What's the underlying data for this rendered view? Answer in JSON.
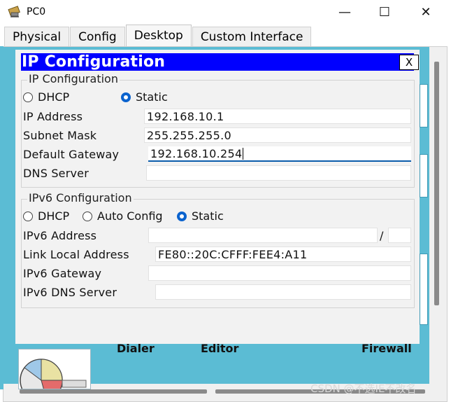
{
  "window": {
    "title": "PC0",
    "minimize_glyph": "—",
    "maximize_glyph": "☐",
    "close_glyph": "✕"
  },
  "tabs": [
    {
      "label": "Physical",
      "active": false
    },
    {
      "label": "Config",
      "active": false
    },
    {
      "label": "Desktop",
      "active": true
    },
    {
      "label": "Custom Interface",
      "active": false
    }
  ],
  "dialog": {
    "title": "IP Configuration",
    "close_label": "X",
    "ipv4": {
      "legend": "IP Configuration",
      "dhcp_label": "DHCP",
      "static_label": "Static",
      "mode": "Static",
      "ip_label": "IP Address",
      "ip_value": "192.168.10.1",
      "mask_label": "Subnet Mask",
      "mask_value": "255.255.255.0",
      "gateway_label": "Default Gateway",
      "gateway_value": "192.168.10.254",
      "dns_label": "DNS Server",
      "dns_value": ""
    },
    "ipv6": {
      "legend": "IPv6 Configuration",
      "dhcp_label": "DHCP",
      "auto_label": "Auto Config",
      "static_label": "Static",
      "mode": "Static",
      "address_label": "IPv6 Address",
      "address_value": "",
      "prefix_separator": "/",
      "prefix_value": "",
      "link_local_label": "Link Local Address",
      "link_local_value": "FE80::20C:CFFF:FEE4:A11",
      "gateway_label": "IPv6 Gateway",
      "gateway_value": "",
      "dns_label": "IPv6 DNS Server",
      "dns_value": ""
    }
  },
  "desktop_apps": [
    "Dialer",
    "Editor",
    "Firewall"
  ],
  "watermark": "CSDN @不选IE不改名",
  "colors": {
    "dialog_title_bg": "#0000ff",
    "desktop_bg": "#5bbcd4",
    "radio_checked": "#0b63ce"
  }
}
